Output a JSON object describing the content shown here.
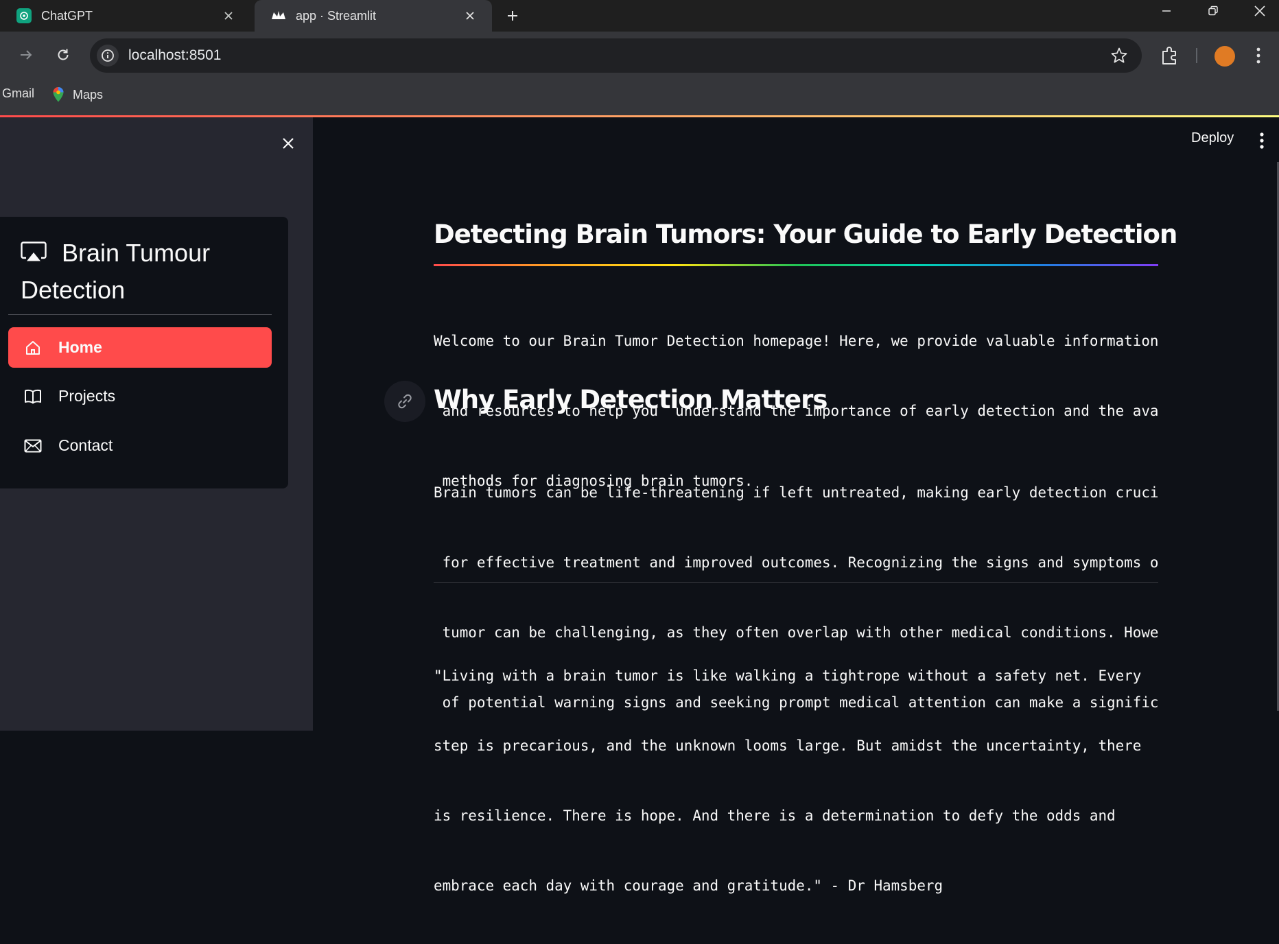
{
  "browser": {
    "tabs": [
      {
        "title": "ChatGPT",
        "active": false
      },
      {
        "title": "app · Streamlit",
        "active": true
      }
    ],
    "url": "localhost:8501",
    "bookmarks": [
      "Gmail",
      "Maps"
    ]
  },
  "sidebar": {
    "menu_title": "Brain Tumour Detection",
    "items": [
      {
        "label": "Home",
        "icon": "house-icon",
        "active": true
      },
      {
        "label": "Projects",
        "icon": "book-icon",
        "active": false
      },
      {
        "label": "Contact",
        "icon": "envelope-icon",
        "active": false
      }
    ]
  },
  "header": {
    "deploy_label": "Deploy"
  },
  "main": {
    "title": "Detecting Brain Tumors: Your Guide to Early Detection",
    "intro_lines": [
      "Welcome to our Brain Tumor Detection homepage! Here, we provide valuable information",
      " and resources to help you  understand the importance of early detection and the ava",
      " methods for diagnosing brain tumors."
    ],
    "section_heading": "Why Early Detection Matters",
    "section_lines": [
      "Brain tumors can be life-threatening if left untreated, making early detection cruci",
      " for effective treatment and improved outcomes. Recognizing the signs and symptoms o",
      " tumor can be challenging, as they often overlap with other medical conditions. Howe",
      " of potential warning signs and seeking prompt medical attention can make a signific"
    ],
    "quote_lines": [
      "\"Living with a brain tumor is like walking a tightrope without a safety net. Every",
      "step is precarious, and the unknown looms large. But amidst the uncertainty, there",
      "is resilience. There is hope. And there is a determination to defy the odds and",
      "embrace each day with courage and gratitude.\" - Dr Hamsberg"
    ]
  },
  "colors": {
    "accent": "#ff4b4b",
    "app_background": "#0e1117",
    "sidebar_background": "#262730",
    "text": "#fafafa"
  }
}
